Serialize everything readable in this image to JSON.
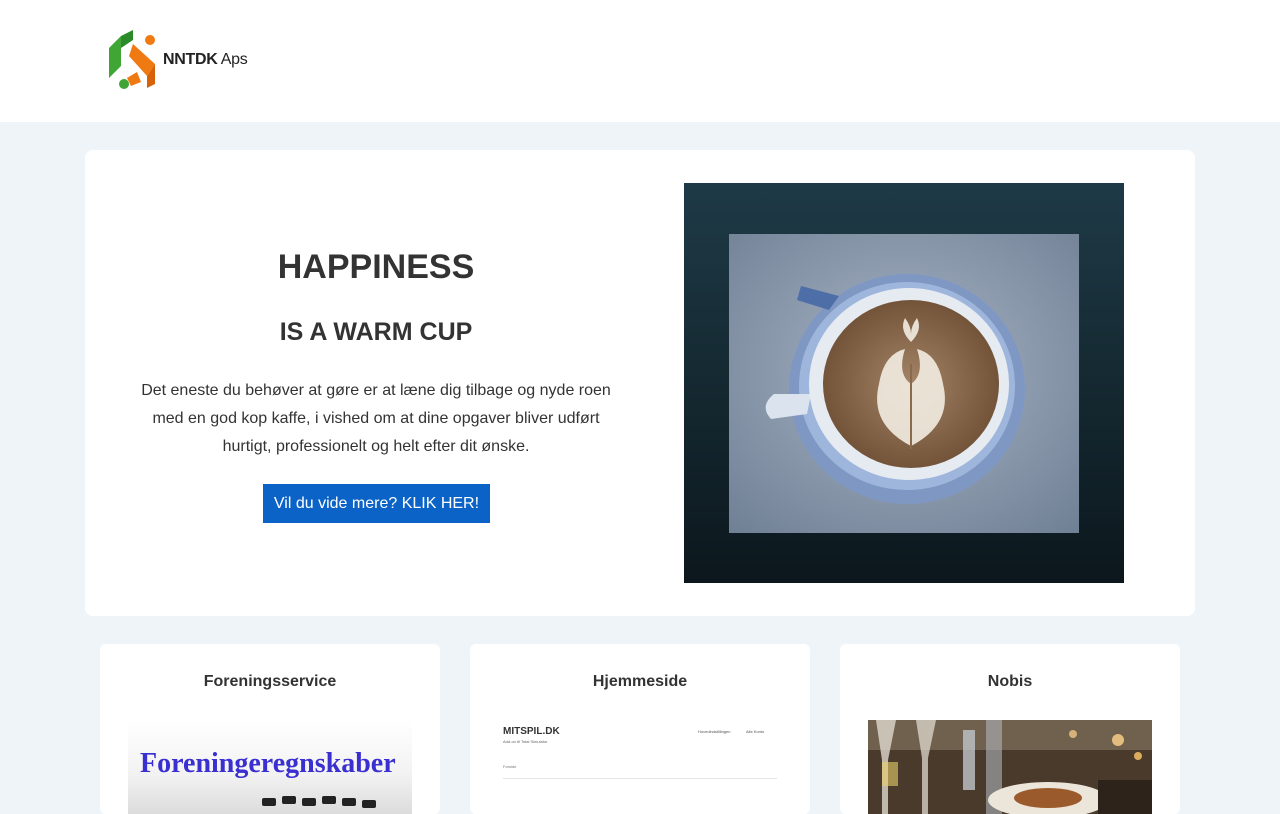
{
  "header": {
    "logo_brand": "NNTDK",
    "logo_suffix": "Aps"
  },
  "hero": {
    "title": "HAPPINESS",
    "subtitle": "IS A WARM CUP",
    "body": "Det eneste du behøver at gøre er at læne dig tilbage og nyde roen med en god kop kaffe, i vished om at dine opgaver bliver udført hurtigt, professionelt og helt efter dit ønske.",
    "button_label": "Vil du vide mere? KLIK HER!"
  },
  "cards": [
    {
      "title": "Foreningsservice",
      "image_text": "Foreningeregnskaber"
    },
    {
      "title": "Hjemmeside",
      "image_text": {
        "logo": "MITSPIL.DK",
        "tagline": "Add-on til Total Simulator",
        "nav_1": "Hovedindstillingen",
        "nav_2": "Alle Konto",
        "side": "Forside"
      }
    },
    {
      "title": "Nobis"
    }
  ],
  "colors": {
    "page_bg": "#eff4f9",
    "button_bg": "#0b63c7",
    "logo_green": "#3fa535",
    "logo_orange": "#f07a12",
    "card_title_text": "#333333"
  }
}
